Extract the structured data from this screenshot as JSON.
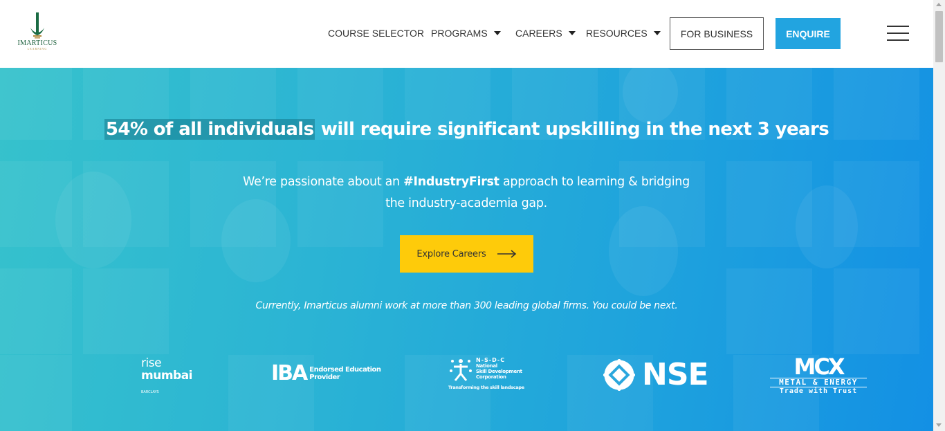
{
  "header": {
    "logo": {
      "word": "IMARTICUS",
      "sub": "LEARNING"
    },
    "nav": [
      {
        "label": "COURSE SELECTOR",
        "dropdown": false
      },
      {
        "label": "PROGRAMS",
        "dropdown": true
      },
      {
        "label": "CAREERS",
        "dropdown": true
      },
      {
        "label": "RESOURCES",
        "dropdown": true
      }
    ],
    "business_label": "FOR BUSINESS",
    "enquire_label": "ENQUIRE",
    "menu_icon": "hamburger-icon"
  },
  "hero": {
    "headline_highlight": "54% of all individuals",
    "headline_rest": " will require significant upskilling in the next 3 years",
    "sub_before": "We’re passionate about an ",
    "sub_bold": "#IndustryFirst",
    "sub_after": " approach to learning & bridging the industry-academia gap.",
    "cta_label": "Explore Careers",
    "cta_icon": "arrow-right-icon",
    "alumni_text": "Currently, Imarticus alumni work at more than 300 leading global firms. You could be next."
  },
  "partners": {
    "rise": {
      "line1": "rise",
      "line2": "mumbai",
      "line3": "BARCLAYS"
    },
    "iba": {
      "mark": "IBA",
      "line1": "Endorsed Education",
      "line2": "Provider"
    },
    "nsdc": {
      "title": "N-S-D-C",
      "line1": "National",
      "line2": "Skill Development",
      "line3": "Corporation",
      "tagline": "Transforming the skill landscape"
    },
    "nse": {
      "word": "NSE"
    },
    "mcx": {
      "word": "MCX",
      "line2": "METAL & ENERGY",
      "line3": "Trade with Trust"
    }
  },
  "colors": {
    "enquire_bg": "#22a4e0",
    "cta_bg": "#fecb0a",
    "hero_start": "#36c2cc",
    "hero_end": "#1390e4"
  }
}
